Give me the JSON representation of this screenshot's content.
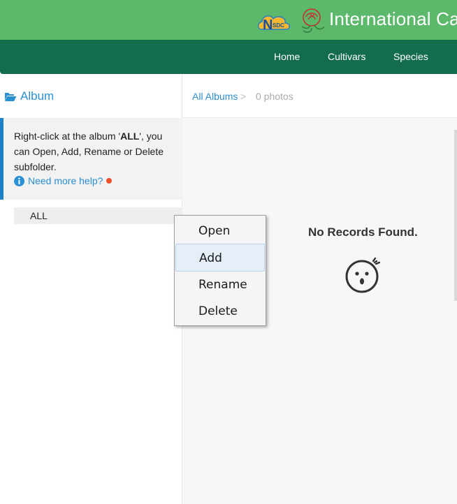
{
  "header": {
    "logo_text": "NSDC",
    "site_title": "International Ca"
  },
  "nav": {
    "items": [
      "Home",
      "Cultivars",
      "Species"
    ]
  },
  "sidebar": {
    "album_title": "Album",
    "help_text_part1": "Right-click at the album '",
    "help_text_bold": "ALL",
    "help_text_part2": "', you can Open, Add, Rename or Delete subfolder.",
    "help_link": "Need more help?",
    "album_node": "ALL"
  },
  "main": {
    "breadcrumb_link": "All Albums",
    "breadcrumb_sep": ">",
    "photo_count": "0 photos",
    "empty_message": "No Records Found."
  },
  "context_menu": {
    "items": [
      "Open",
      "Add",
      "Rename",
      "Delete"
    ],
    "highlighted": "Add"
  },
  "colors": {
    "topbar": "#5cb86a",
    "navbar": "#136d4d",
    "accent": "#2b8fd3",
    "help_border": "#1d80c8",
    "notice_dot": "#f0522d"
  }
}
